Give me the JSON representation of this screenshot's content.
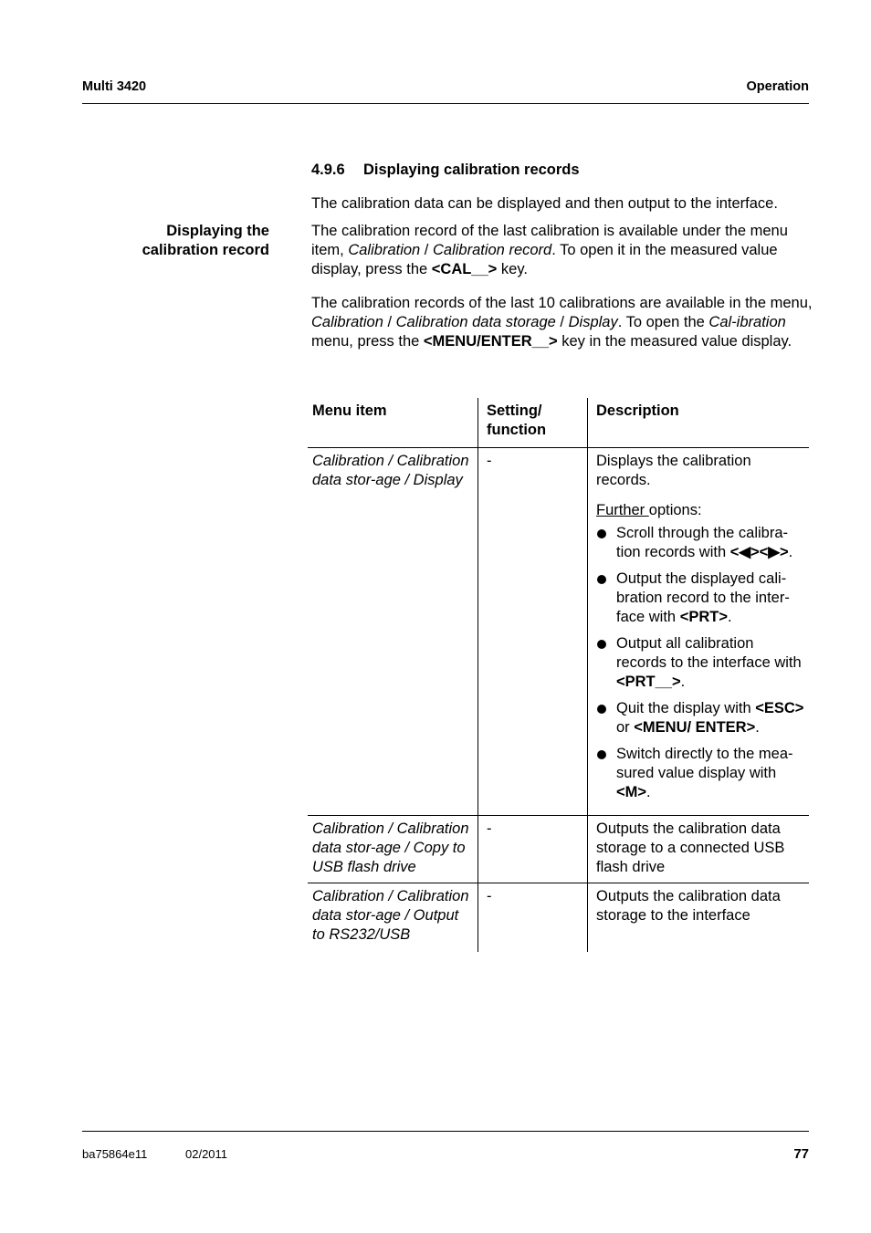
{
  "header": {
    "left": "Multi 3420",
    "right": "Operation"
  },
  "section": {
    "number": "4.9.6",
    "title": "Displaying calibration records"
  },
  "intro": "The calibration data can be displayed and then output to the interface.",
  "side_heading": {
    "line1": "Displaying the",
    "line2": "calibration record"
  },
  "para2": {
    "t1": "The calibration record of the last calibration is available under the menu item, ",
    "i1": "Calibration",
    "t2": " / ",
    "i2": "Calibration record",
    "t3": ". To open it in the measured value display, press the ",
    "b1": "<CAL__>",
    "t4": " key."
  },
  "para3": {
    "t1": "The calibration records of the last 10 calibrations are available in the menu, ",
    "i1": "Calibration",
    "t2": " / ",
    "i2": "Calibration data storage",
    "t3": " / ",
    "i3": "Display",
    "t4": ". To open the ",
    "i4": "Cal-ibration",
    "t5": " menu, press the ",
    "b1": "<MENU/ENTER__>",
    "t6": " key in the measured value display."
  },
  "table": {
    "headers": [
      "Menu item",
      "Setting/ function",
      "Description"
    ],
    "rows": [
      {
        "menu_item": "Calibration / Calibration data stor-age / Display",
        "setting": "-",
        "description": "Displays the calibration records.",
        "further_label": "Further ",
        "further_rest": "options:",
        "options": [
          {
            "text": "Scroll through the calibra-tion records with ",
            "key": "<◀><▶>",
            "end": "."
          },
          {
            "text": "Output the displayed cali-bration record to the inter-face with ",
            "key": "<PRT>",
            "end": "."
          },
          {
            "text": "Output all calibration records to the interface with ",
            "key": "<PRT__>",
            "end": "."
          },
          {
            "text": "Quit the display with ",
            "key": "<ESC>",
            "mid": " or ",
            "key2": "<MENU/ ENTER>",
            "end": "."
          },
          {
            "text": "Switch directly to the mea-sured value display with ",
            "key": "<M>",
            "end": "."
          }
        ]
      },
      {
        "menu_item": "Calibration / Calibration data stor-age / Copy to USB flash drive",
        "setting": "-",
        "description": "Outputs the calibration data storage to a connected USB flash drive"
      },
      {
        "menu_item": "Calibration / Calibration data stor-age / Output to RS232/USB",
        "setting": "-",
        "description": "Outputs the calibration data storage to the interface"
      }
    ]
  },
  "footer": {
    "doc_id": "ba75864e11",
    "date": "02/2011",
    "page": "77"
  }
}
